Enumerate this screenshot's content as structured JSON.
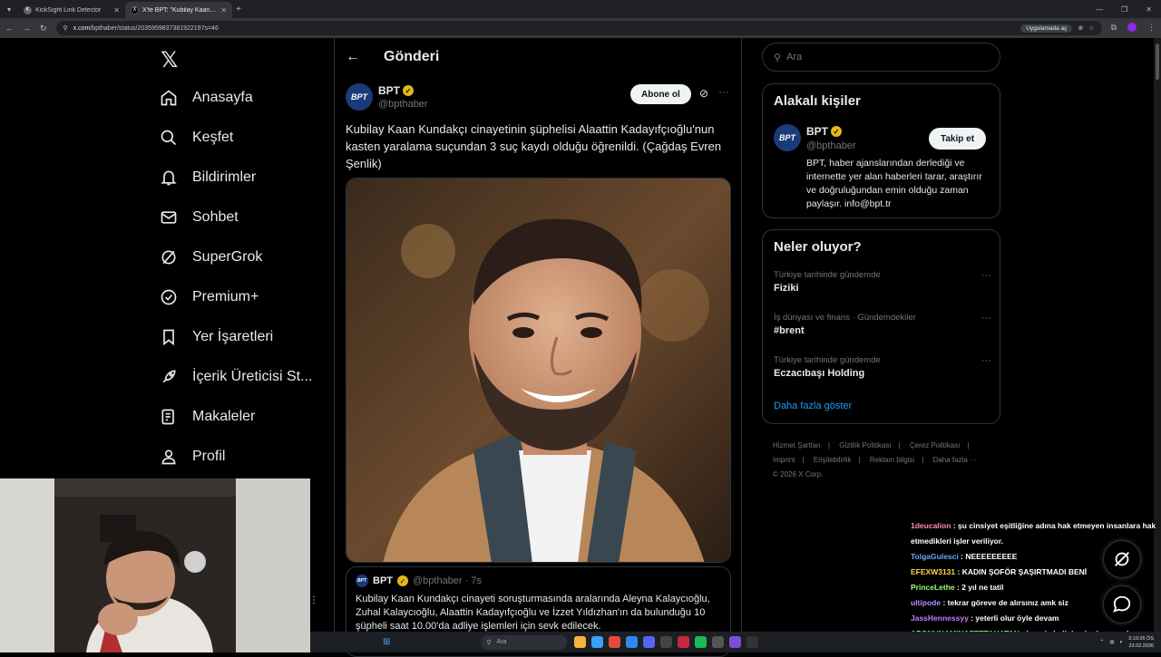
{
  "browser": {
    "tabs": [
      {
        "title": "KickSight Link Detector",
        "active": false
      },
      {
        "title": "X'te BPT: \"Kubilay Kaan Kundakçı...",
        "active": true
      }
    ],
    "url_host": "x.com",
    "url_path": "/bpthaber/status/2035959837381922197s=46",
    "open_in_app": "Uygulamada aç"
  },
  "nav": {
    "items": [
      {
        "label": "Anasayfa",
        "icon": "home-icon"
      },
      {
        "label": "Keşfet",
        "icon": "search-icon"
      },
      {
        "label": "Bildirimler",
        "icon": "bell-icon"
      },
      {
        "label": "Sohbet",
        "icon": "mail-icon"
      },
      {
        "label": "SuperGrok",
        "icon": "grok-icon"
      },
      {
        "label": "Premium+",
        "icon": "premium-icon"
      },
      {
        "label": "Yer İşaretleri",
        "icon": "bookmark-icon"
      },
      {
        "label": "İçerik Üreticisi St...",
        "icon": "rocket-icon"
      },
      {
        "label": "Makaleler",
        "icon": "article-icon"
      },
      {
        "label": "Profil",
        "icon": "profile-icon"
      }
    ]
  },
  "main": {
    "header_title": "Gönderi",
    "post": {
      "avatar_text": "BPT",
      "name": "BPT",
      "handle": "@bpthaber",
      "follow_label": "Abone ol",
      "text": "Kubilay Kaan Kundakçı cinayetinin şüphelisi Alaattin Kadayıfçıoğlu'nun kasten yaralama suçundan 3 suç kaydı olduğu öğrenildi. (Çağdaş Evren Şenlik)"
    },
    "quote": {
      "name": "BPT",
      "meta": "@bpthaber · 7s",
      "text": "Kubilay Kaan Kundakçı cinayeti soruşturmasında aralarında Aleyna Kalaycıoğlu, Zuhal Kalaycıoğlu, Alaattin Kadayıfçıoğlu ve İzzet Yıldızhan'ın da bulunduğu 10 şüpheli saat 10.00'da adliye işlemleri için sevk edilecek."
    }
  },
  "right": {
    "search_placeholder": "Ara",
    "related": {
      "title": "Alakalı kişiler",
      "name": "BPT",
      "handle": "@bpthaber",
      "follow_label": "Takip et",
      "bio": "BPT, haber ajanslarından derlediği ve internette yer alan haberleri tarar, araştırır ve doğruluğundan emin olduğu zaman paylaşır. info@bpt.tr"
    },
    "trends": {
      "title": "Neler oluyor?",
      "items": [
        {
          "meta": "Türkiye tarihinde gündemde",
          "name": "Fiziki"
        },
        {
          "meta": "İş dünyası ve finans · Gündemdekiler",
          "name": "#brent"
        },
        {
          "meta": "Türkiye tarihinde gündemde",
          "name": "Eczacıbaşı Holding"
        }
      ],
      "show_more": "Daha fazla göster"
    },
    "footer": [
      "Hizmet Şartları",
      "|",
      "Gizlilik Politikası",
      "|",
      "Çerez Politikası",
      "|",
      "Imprint",
      "|",
      "Erişilebilirlik",
      "|",
      "Reklam bilgisi",
      "|",
      "Daha fazla ···",
      "© 2026 X Corp."
    ]
  },
  "chat": [
    {
      "user": "1deucalion",
      "color": "#ff8fb3",
      "msg": ": şu cinsiyet eşitliğine adına hak etmeyen insanlara hak etmedikleri işler veriliyor."
    },
    {
      "user": "TolgaGulesci",
      "color": "#6ea8ff",
      "msg": ": NEEEEEEEEE"
    },
    {
      "user": "EFEXW3131",
      "color": "#ffd54a",
      "msg": ": KADIN ŞOFÖR ŞAŞIRTMADI BENİ"
    },
    {
      "user": "PrinceLethe",
      "color": "#9cff7a",
      "msg": ": 2 yıl ne tatil"
    },
    {
      "user": "ultipode",
      "color": "#b58cff",
      "msg": ": tekrar göreve de alırsınız amk siz"
    },
    {
      "user": "JassHennessyy",
      "color": "#c77dff",
      "msg": ": yeterli olur öyle devam"
    },
    {
      "user": "APONUNAMINAFETTAHATAN",
      "color": "#7dff7d",
      "msg": ": hangi akplinin akrabası acaba"
    }
  ],
  "taskbar": {
    "search_placeholder": "Ara",
    "time": "3:10:26 ÖS",
    "date": "23.03.2026"
  }
}
